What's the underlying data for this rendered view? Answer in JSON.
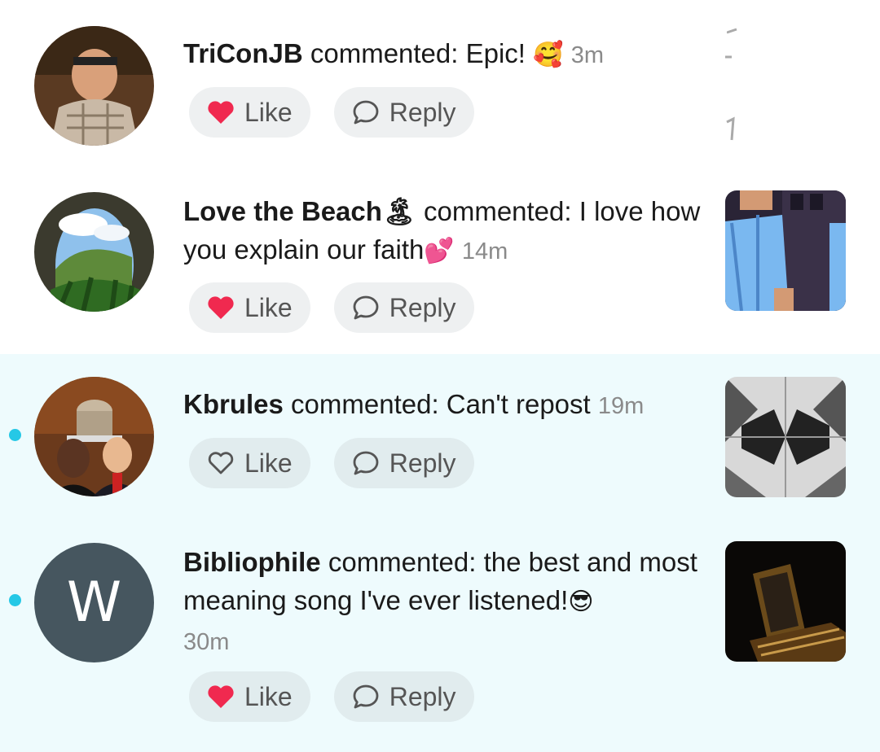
{
  "notifications": [
    {
      "user": "TriConJB",
      "verb": " commented: ",
      "text": "Epic! ",
      "emoji": "🥰",
      "time": "3m",
      "liked": true,
      "unread": false,
      "like_label": "Like",
      "reply_label": "Reply"
    },
    {
      "user": "Love the Beach🏝",
      "verb": " commented: ",
      "text": "I love how you explain our faith",
      "emoji": "💕",
      "time": "14m",
      "liked": true,
      "unread": false,
      "like_label": "Like",
      "reply_label": "Reply"
    },
    {
      "user": "Kbrules",
      "verb": " commented: ",
      "text": "Can't repost",
      "emoji": "",
      "time": "19m",
      "liked": false,
      "unread": true,
      "like_label": "Like",
      "reply_label": "Reply"
    },
    {
      "user": "Bibliophile",
      "verb": " commented: ",
      "text": "the best and most meaning song I've ever listened!",
      "emoji": "😎",
      "time": "30m",
      "liked": true,
      "unread": true,
      "avatar_letter": "W",
      "like_label": "Like",
      "reply_label": "Reply"
    }
  ],
  "colors": {
    "unread_background": "#eefbfd",
    "unread_dot": "#25c8e6",
    "like_heart": "#f0294f",
    "letter_avatar": "#46565f"
  },
  "icons": {
    "liked": "heart-filled-icon",
    "not_liked": "heart-outline-icon",
    "reply": "speech-bubble-icon"
  }
}
